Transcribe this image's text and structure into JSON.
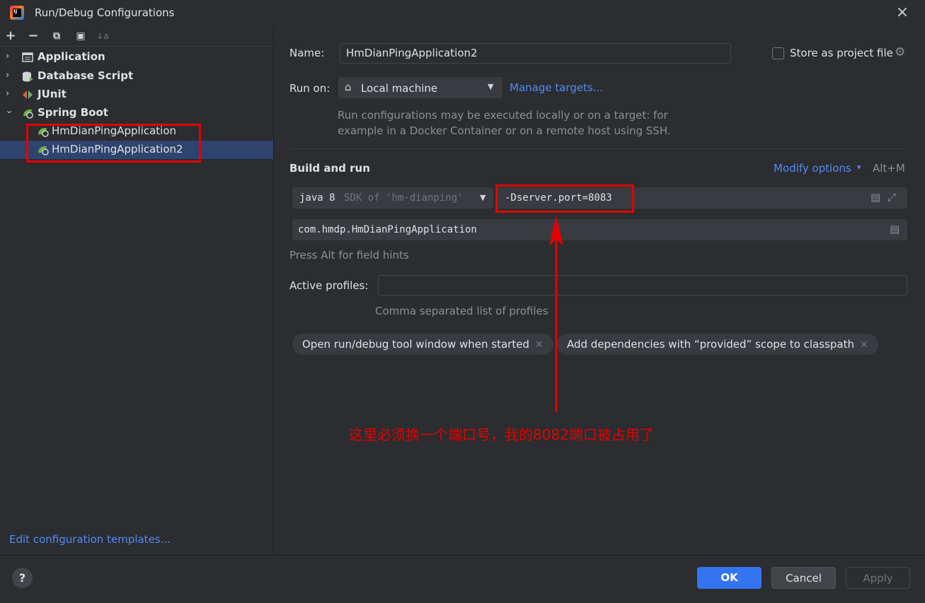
{
  "window": {
    "title": "Run/Debug Configurations",
    "close_icon": "×"
  },
  "toolbar": {
    "add": "+",
    "remove": "−",
    "copy": "⧉",
    "folder": "▣",
    "sort": "↓a"
  },
  "tree": {
    "items": [
      {
        "label": "Application",
        "icon": "application-icon"
      },
      {
        "label": "Database Script",
        "icon": "database-script-icon"
      },
      {
        "label": "JUnit",
        "icon": "junit-icon"
      },
      {
        "label": "Spring Boot",
        "icon": "spring-boot-icon"
      }
    ],
    "children": [
      {
        "label": "HmDianPingApplication"
      },
      {
        "label": "HmDianPingApplication2"
      }
    ],
    "edit_templates": "Edit configuration templates..."
  },
  "form": {
    "name_label": "Name:",
    "name_value": "HmDianPingApplication2",
    "store_label": "Store as project file",
    "run_on_label": "Run on:",
    "run_on_value": "Local machine",
    "manage_targets": "Manage targets...",
    "run_on_hint_1": "Run configurations may be executed locally or on a target: for",
    "run_on_hint_2": "example in a Docker Container or on a remote host using SSH.",
    "build_and_run": "Build and run",
    "modify_options": "Modify options",
    "modify_shortcut": "Alt+M",
    "jdk_main": "java 8",
    "jdk_sub": "SDK of 'hm-dianping'",
    "vm_options": "-Dserver.port=8083",
    "main_class": "com.hmdp.HmDianPingApplication",
    "field_hints": "Press Alt for field hints",
    "active_profiles_label": "Active profiles:",
    "active_profiles_value": "",
    "profiles_hint": "Comma separated list of profiles",
    "chips": [
      "Open run/debug tool window when started",
      "Add dependencies with “provided” scope to classpath"
    ]
  },
  "annotation": {
    "text": "这里必须换一个端口号，我的8082端口被占用了",
    "color": "#e50000"
  },
  "footer": {
    "help": "?",
    "ok": "OK",
    "cancel": "Cancel",
    "apply": "Apply"
  },
  "colors": {
    "background": "#2b2d30",
    "accent": "#548af7",
    "selection": "#2e436e",
    "primary_button": "#3574f0",
    "spring_green": "#6db33f"
  }
}
